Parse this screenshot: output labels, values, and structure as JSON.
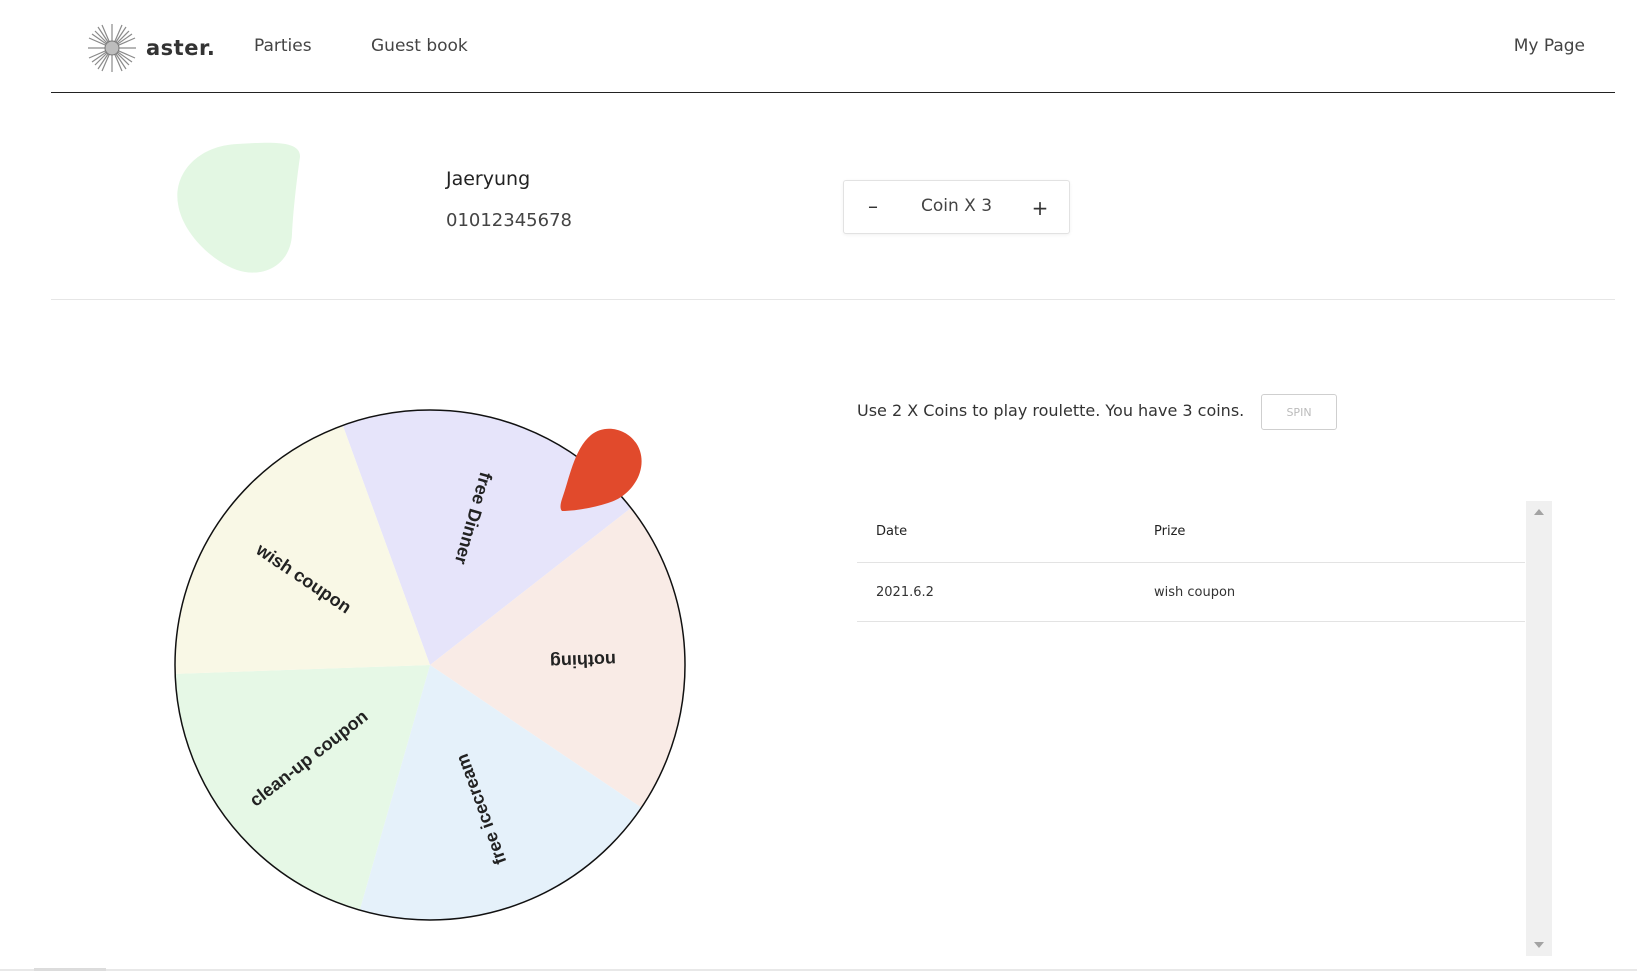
{
  "brand": {
    "name": "aster."
  },
  "nav": {
    "items": [
      "Parties",
      "Guest book"
    ],
    "right": "My Page"
  },
  "profile": {
    "name": "Jaeryung",
    "phone": "01012345678",
    "avatar_color": "#e3f7e3"
  },
  "coins": {
    "minus": "–",
    "label": "Coin X 3",
    "plus": "+"
  },
  "roulette": {
    "info": "Use 2 X Coins to play roulette. You have 3 coins.",
    "spin_label": "SPIN",
    "pointer_color": "#e14a2c",
    "segments": [
      {
        "label": "free Dinner",
        "color": "#e6e4fa"
      },
      {
        "label": "nothing",
        "color": "#f9ebe6"
      },
      {
        "label": "free icecream",
        "color": "#e5f1fa"
      },
      {
        "label": "clean-up coupon",
        "color": "#e6f8e6"
      },
      {
        "label": "wish coupon",
        "color": "#f9f8e6"
      }
    ]
  },
  "history": {
    "headers": {
      "date": "Date",
      "prize": "Prize"
    },
    "rows": [
      {
        "date": "2021.6.2",
        "prize": "wish coupon"
      }
    ]
  }
}
